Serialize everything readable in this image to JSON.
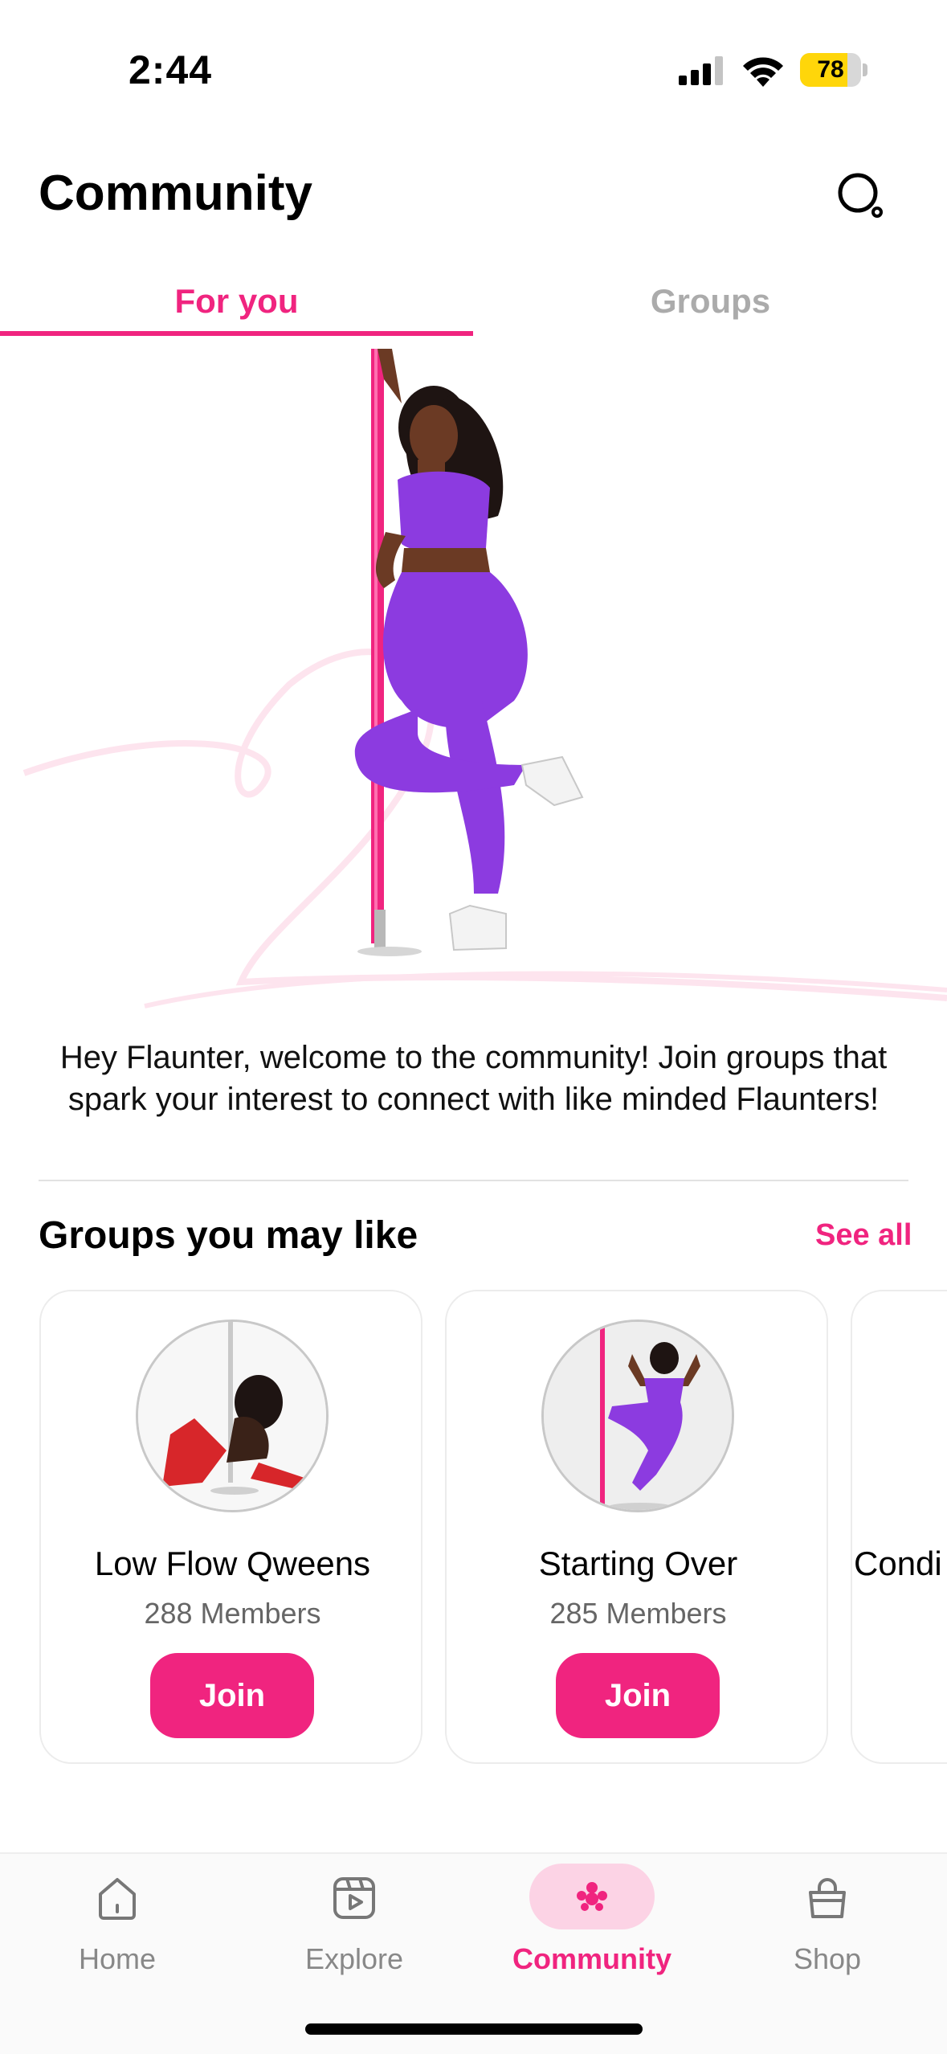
{
  "status_bar": {
    "time": "2:44",
    "battery_level": "78",
    "battery_fraction": 0.78
  },
  "header": {
    "title": "Community"
  },
  "tabs": [
    {
      "label": "For you",
      "active": true
    },
    {
      "label": "Groups",
      "active": false
    }
  ],
  "welcome": {
    "text": "Hey Flaunter, welcome to the community! Join groups that spark your interest to connect with like minded Flaunters!"
  },
  "groups_section": {
    "title": "Groups you may like",
    "see_all_label": "See all"
  },
  "groups": [
    {
      "name": "Low Flow Qweens",
      "members": "288 Members",
      "join_label": "Join"
    },
    {
      "name": "Starting Over",
      "members": "285 Members",
      "join_label": "Join"
    },
    {
      "name": "Condi"
    }
  ],
  "bottom_nav": [
    {
      "label": "Home",
      "icon": "home-icon",
      "active": false
    },
    {
      "label": "Explore",
      "icon": "explore-icon",
      "active": false
    },
    {
      "label": "Community",
      "icon": "community-icon",
      "active": true
    },
    {
      "label": "Shop",
      "icon": "shop-icon",
      "active": false
    }
  ],
  "colors": {
    "accent": "#f0247f",
    "accent_light": "#fcd3e5",
    "battery": "#ffd60a",
    "inactive_tab": "#ababab"
  }
}
